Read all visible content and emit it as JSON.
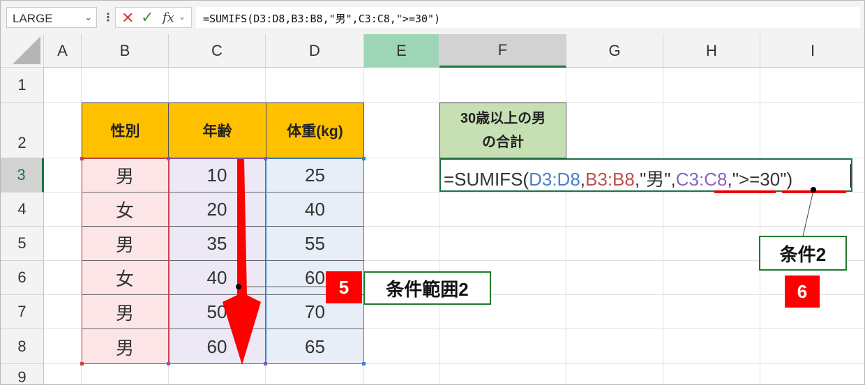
{
  "formula_bar": {
    "name_box": "LARGE",
    "formula": "=SUMIFS(D3:D8,B3:B8,\"男\",C3:C8,\">=30\")"
  },
  "columns": [
    "A",
    "B",
    "C",
    "D",
    "E",
    "F",
    "G",
    "H",
    "I"
  ],
  "rows": [
    "1",
    "2",
    "3",
    "4",
    "5",
    "6",
    "7",
    "8",
    "9"
  ],
  "table": {
    "headers": [
      "性別",
      "年齢",
      "体重(kg)"
    ],
    "gender": [
      "男",
      "女",
      "男",
      "女",
      "男",
      "男"
    ],
    "age": [
      "10",
      "20",
      "35",
      "40",
      "50",
      "60"
    ],
    "weight": [
      "25",
      "40",
      "55",
      "60",
      "70",
      "65"
    ]
  },
  "result_header": {
    "line1": "30歳以上の男",
    "line2": "の合計"
  },
  "edit_formula": {
    "p1": "=SUMIFS(",
    "p2": "D3:D8",
    "p3": ",",
    "p4": "B3:B8",
    "p5": ",\"男\",",
    "p6": "C3:C8",
    "p7": ",\">=30\")"
  },
  "annotations": {
    "criteria_range_label": "条件範囲2",
    "criteria_range_number": "5",
    "criteria_label": "条件2",
    "criteria_number": "6"
  },
  "colors": {
    "header_fill": "#ffc000",
    "result_fill": "#c6e0b4",
    "active_green": "#1e7145",
    "annotation_red": "#ff0000",
    "ref_blue": "#4a7fc9",
    "ref_red": "#c0504d",
    "ref_purple": "#8c62c2"
  }
}
